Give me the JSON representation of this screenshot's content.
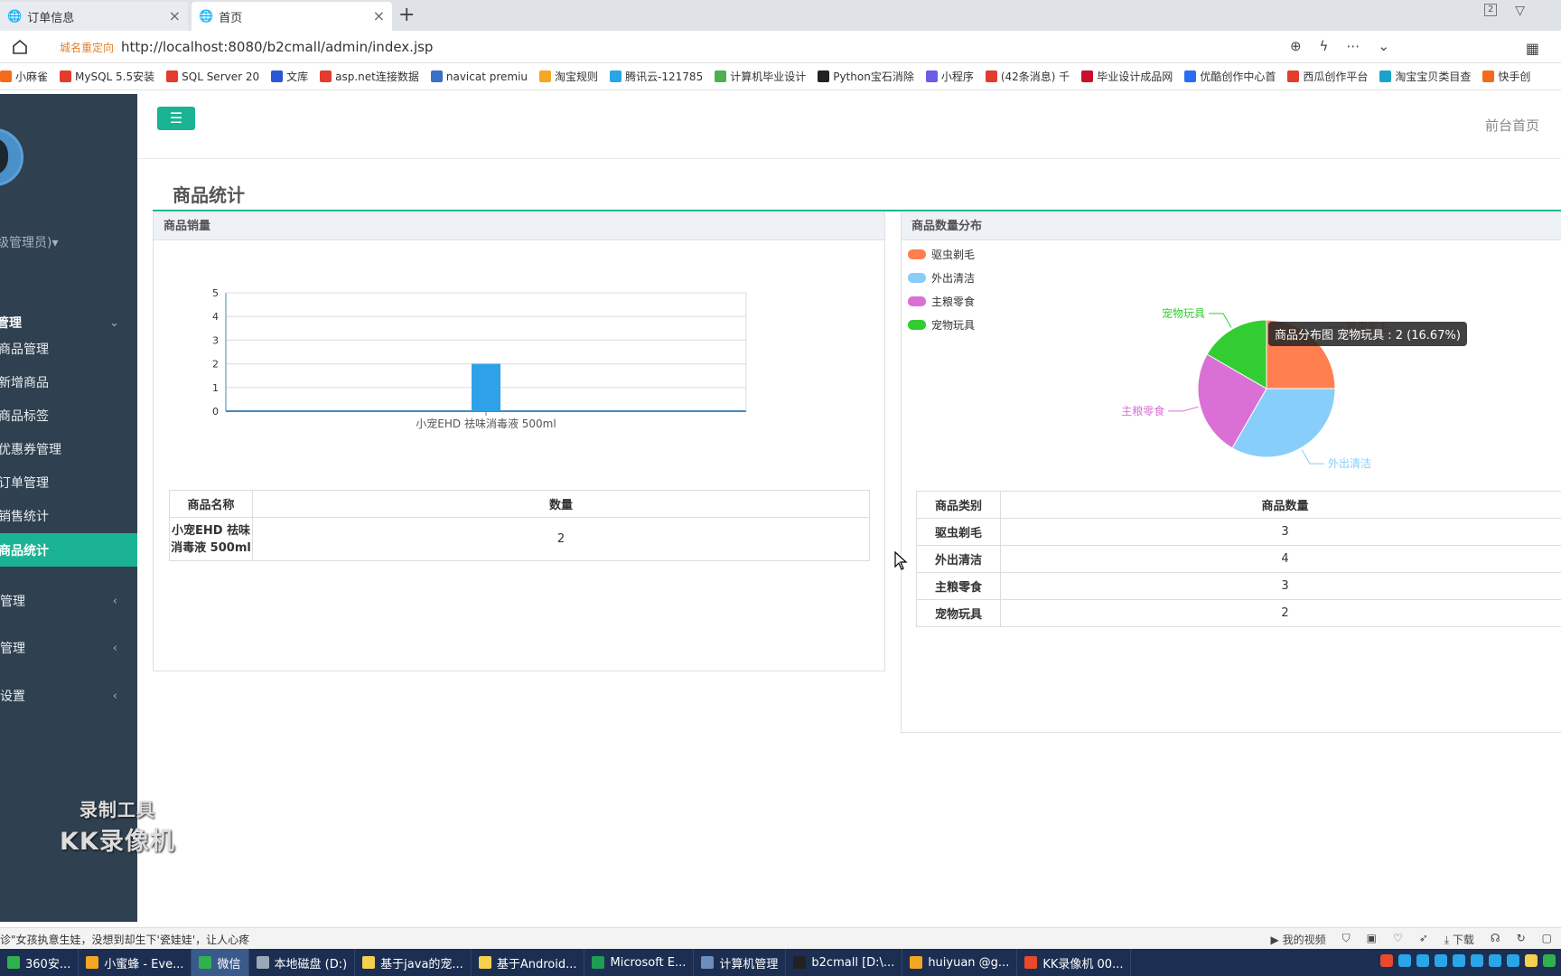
{
  "browser": {
    "tabs": [
      {
        "label": "订单信息",
        "close": "×"
      },
      {
        "label": "首页",
        "close": "×"
      }
    ],
    "new_tab": "+",
    "window_badge": "2",
    "address_tag": "城名重定向",
    "url": "http://localhost:8080/b2cmall/admin/index.jsp",
    "bookmarks": [
      {
        "label": "小麻雀",
        "color": "#f26b1d"
      },
      {
        "label": "MySQL 5.5安装",
        "color": "#e33b2e"
      },
      {
        "label": "SQL Server 20",
        "color": "#e33b2e"
      },
      {
        "label": "文库",
        "color": "#2b57d6"
      },
      {
        "label": "asp.net连接数据",
        "color": "#e33b2e"
      },
      {
        "label": "navicat premiu",
        "color": "#3a6fc8"
      },
      {
        "label": "淘宝规则",
        "color": "#f5a623"
      },
      {
        "label": "腾讯云-121785",
        "color": "#2aa5e8"
      },
      {
        "label": "计算机毕业设计",
        "color": "#4caf50"
      },
      {
        "label": "Python宝石消除",
        "color": "#222222"
      },
      {
        "label": "小程序",
        "color": "#6c5ce7"
      },
      {
        "label": "(42条消息) 千",
        "color": "#e33b2e"
      },
      {
        "label": "毕业设计成品网",
        "color": "#c8102e"
      },
      {
        "label": "优酷创作中心首",
        "color": "#2a6df4"
      },
      {
        "label": "西瓜创作平台",
        "color": "#e33b2e"
      },
      {
        "label": "淘宝宝贝类目查",
        "color": "#1aa3c8"
      },
      {
        "label": "快手创",
        "color": "#f26b1d"
      }
    ]
  },
  "sidebar": {
    "user_role": "级管理员)",
    "group": "管理",
    "items": [
      {
        "label": "商品管理"
      },
      {
        "label": "新增商品"
      },
      {
        "label": "商品标签"
      },
      {
        "label": "优惠券管理"
      },
      {
        "label": "订单管理"
      },
      {
        "label": "销售统计"
      },
      {
        "label": "商品统计"
      }
    ],
    "sub_groups": [
      {
        "label": "管理"
      },
      {
        "label": "管理"
      },
      {
        "label": "设置"
      }
    ],
    "watermark_line1": "录制工具",
    "watermark_line2": "KK录像机"
  },
  "header": {
    "front_link": "前台首页"
  },
  "page": {
    "title": "商品统计"
  },
  "sales_panel": {
    "title": "商品销量",
    "table_headers": [
      "商品名称",
      "数量"
    ],
    "rows": [
      {
        "name_line1": "小宠EHD 祛味",
        "name_line2": "消毒液 500ml",
        "qty": "2"
      }
    ]
  },
  "dist_panel": {
    "title": "商品数量分布",
    "tooltip": "商品分布图 宠物玩具 : 2 (16.67%)",
    "table_headers": [
      "商品类别",
      "商品数量"
    ],
    "rows": [
      {
        "category": "驱虫剃毛",
        "count": "3"
      },
      {
        "category": "外出清洁",
        "count": "4"
      },
      {
        "category": "主粮零食",
        "count": "3"
      },
      {
        "category": "宠物玩具",
        "count": "2"
      }
    ]
  },
  "chart_data": [
    {
      "type": "bar",
      "categories": [
        "小宠EHD 祛味消毒液 500ml"
      ],
      "values": [
        2
      ],
      "ylim": [
        0,
        5
      ],
      "yticks": [
        0,
        1,
        2,
        3,
        4,
        5
      ],
      "grid": true,
      "color": "#2ea1e8"
    },
    {
      "type": "pie",
      "labels": [
        "驱虫剃毛",
        "外出清洁",
        "主粮零食",
        "宠物玩具"
      ],
      "values": [
        3,
        4,
        3,
        2
      ],
      "colors": [
        "#ff7f50",
        "#87cefa",
        "#da70d6",
        "#32cd32"
      ],
      "legend_position": "top-left"
    }
  ],
  "statusbar": {
    "text": "诊\"女孩执意生娃，没想到却生下'瓷娃娃'，让人心疼",
    "tools": [
      "我的视频",
      "下载"
    ]
  },
  "taskbar": {
    "items": [
      {
        "label": "360安...",
        "color": "#2fb24c"
      },
      {
        "label": "小蜜蜂 - Eve...",
        "color": "#f5a623"
      },
      {
        "label": "微信",
        "color": "#2fb24c"
      },
      {
        "label": "本地磁盘 (D:)",
        "color": "#9aa8b8"
      },
      {
        "label": "基于java的宠...",
        "color": "#f5d04e"
      },
      {
        "label": "基于Android...",
        "color": "#f5d04e"
      },
      {
        "label": "Microsoft E...",
        "color": "#1f9d55"
      },
      {
        "label": "计算机管理",
        "color": "#6c8ebf"
      },
      {
        "label": "b2cmall [D:\\...",
        "color": "#222222"
      },
      {
        "label": "huiyuan @g...",
        "color": "#f5a623"
      },
      {
        "label": "KK录像机 00...",
        "color": "#e84a2b"
      }
    ]
  }
}
